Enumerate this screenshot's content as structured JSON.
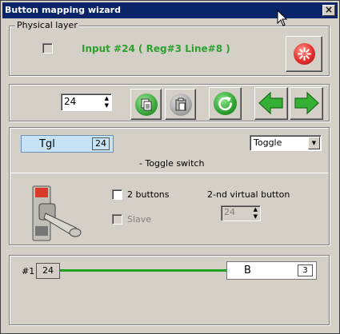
{
  "window": {
    "title": "Button mapping wizard"
  },
  "physical": {
    "legend": "Physical layer",
    "status": "Input #24  ( Reg#3  Line#8 )"
  },
  "toolbar": {
    "spin_value": "24"
  },
  "mapping": {
    "tgl_label": "Tgl",
    "tgl_number": "24",
    "mode_selected": "Toggle",
    "description": "- Toggle switch",
    "two_buttons_label": "2 buttons",
    "slave_label": "Slave",
    "second_vbutton_label": "2-nd virtual button",
    "second_vbutton_value": "24"
  },
  "virtual": {
    "index": "#1",
    "input_number": "24",
    "button_label": "B",
    "button_number": "3"
  },
  "colors": {
    "title_bg": "#0a246a",
    "status_text": "#2ea02e",
    "link_line": "#20a020",
    "tgl_bg": "#c6e2f5",
    "stop_button": "#e53030"
  }
}
